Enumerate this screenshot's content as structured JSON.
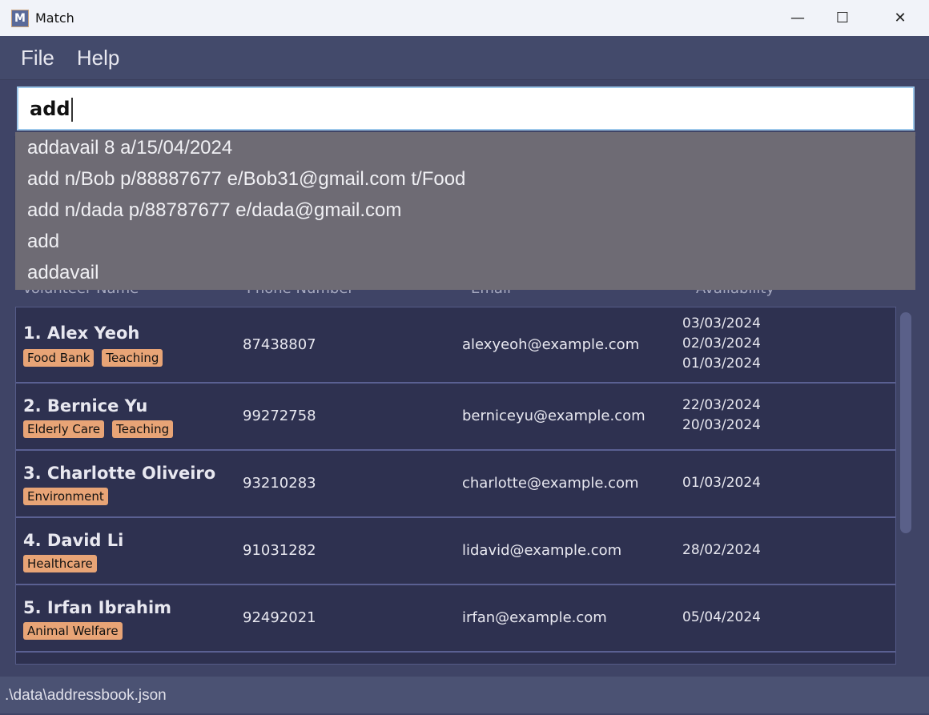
{
  "window": {
    "title": "Match",
    "minimize": "—",
    "maximize": "☐",
    "close": "✕"
  },
  "menu": {
    "file": "File",
    "help": "Help"
  },
  "command": {
    "value": "add"
  },
  "suggestions": [
    "addavail 8 a/15/04/2024",
    "add n/Bob p/88887677 e/Bob31@gmail.com t/Food",
    "add n/dada p/88787677 e/dada@gmail.com",
    "add",
    "addavail"
  ],
  "columns": {
    "name": "Volunteer Name",
    "phone": "Phone Number",
    "email": "Email",
    "availability": "Availability"
  },
  "persons": [
    {
      "name": "1. Alex Yeoh",
      "tags": [
        "Food Bank",
        "Teaching"
      ],
      "phone": "87438807",
      "email": "alexyeoh@example.com",
      "availability": [
        "03/03/2024",
        "02/03/2024",
        "01/03/2024"
      ]
    },
    {
      "name": "2. Bernice Yu",
      "tags": [
        "Elderly Care",
        "Teaching"
      ],
      "phone": "99272758",
      "email": "berniceyu@example.com",
      "availability": [
        "22/03/2024",
        "20/03/2024"
      ]
    },
    {
      "name": "3. Charlotte Oliveiro",
      "tags": [
        "Environment"
      ],
      "phone": "93210283",
      "email": "charlotte@example.com",
      "availability": [
        "01/03/2024"
      ]
    },
    {
      "name": "4. David Li",
      "tags": [
        "Healthcare"
      ],
      "phone": "91031282",
      "email": "lidavid@example.com",
      "availability": [
        "28/02/2024"
      ]
    },
    {
      "name": "5. Irfan Ibrahim",
      "tags": [
        "Animal Welfare"
      ],
      "phone": "92492021",
      "email": "irfan@example.com",
      "availability": [
        "05/04/2024"
      ]
    }
  ],
  "status": {
    "path": ".\\data\\addressbook.json"
  },
  "colors": {
    "tag": "#e8a476",
    "list_bg": "#2e3150",
    "menu_bg": "#434a6b"
  }
}
